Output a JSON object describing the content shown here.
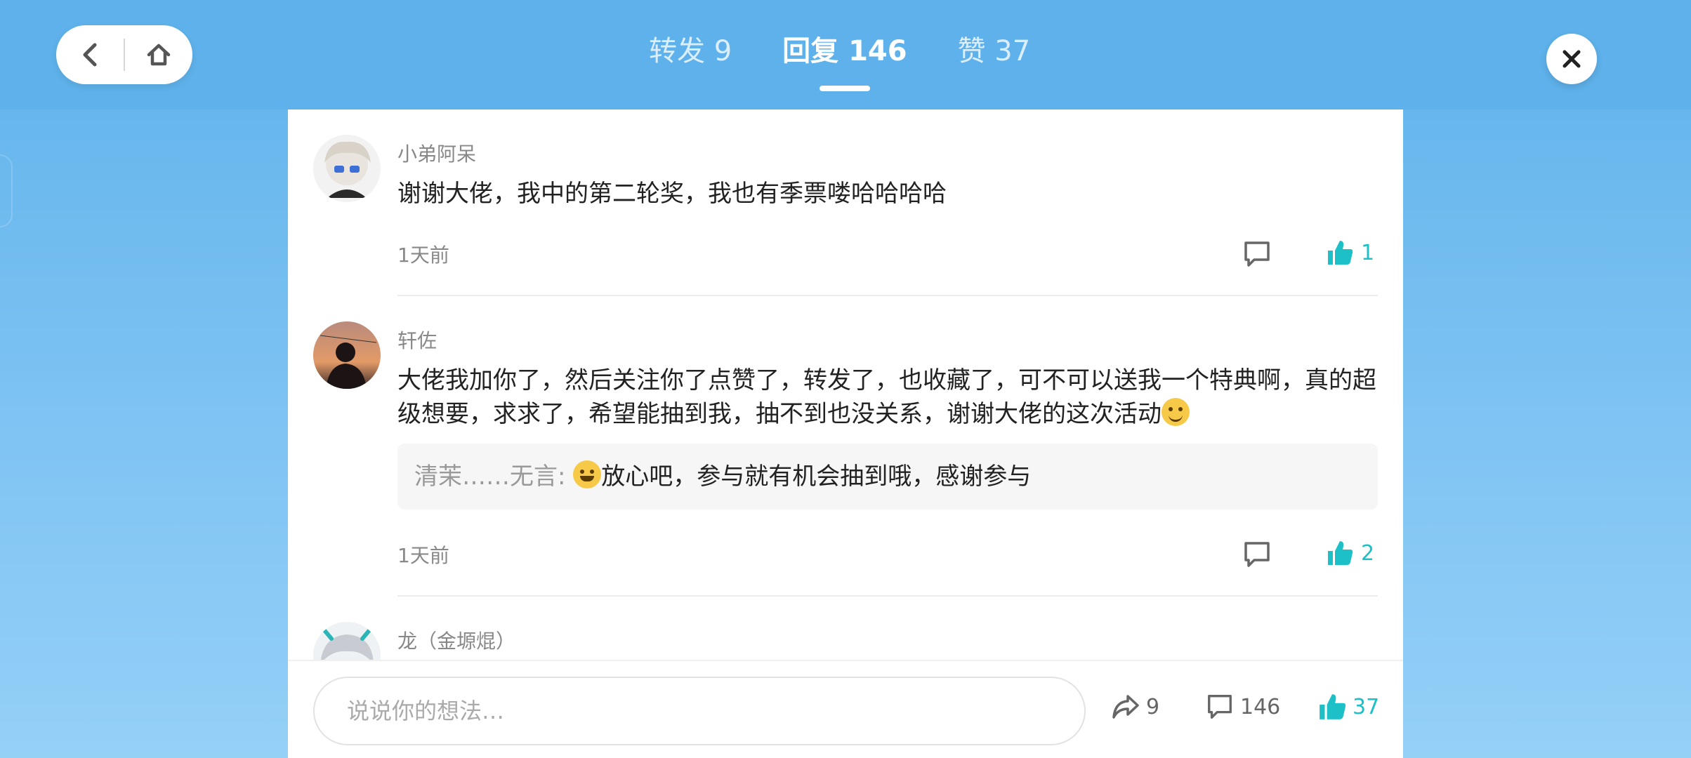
{
  "topbar": {
    "tabs": [
      {
        "label": "转发 9"
      },
      {
        "label": "回复 146"
      },
      {
        "label": "赞 37"
      }
    ],
    "active_tab": "回复 146"
  },
  "comments": [
    {
      "username": "小弟阿呆",
      "text": "谢谢大佬，我中的第二轮奖，我也有季票喽哈哈哈哈",
      "time": "1天前",
      "likes": "1"
    },
    {
      "username": "轩佐",
      "text": "大佬我加你了，然后关注你了点赞了，转发了，也收藏了，可不可以送我一个特典啊，真的超级想要，求求了，希望能抽到我，抽不到也没关系，谢谢大佬的这次活动",
      "reply_name": "清茉……无言:",
      "reply_text": "放心吧，参与就有机会抽到哦，感谢参与",
      "time": "1天前",
      "likes": "2"
    },
    {
      "username": "龙（金塬焜）"
    }
  ],
  "bottom": {
    "input_placeholder": "说说你的想法…",
    "share_count": "9",
    "comment_count": "146",
    "like_count": "37"
  },
  "colors": {
    "accent": "#1ec0c7",
    "topbar": "#5eb1ea"
  }
}
